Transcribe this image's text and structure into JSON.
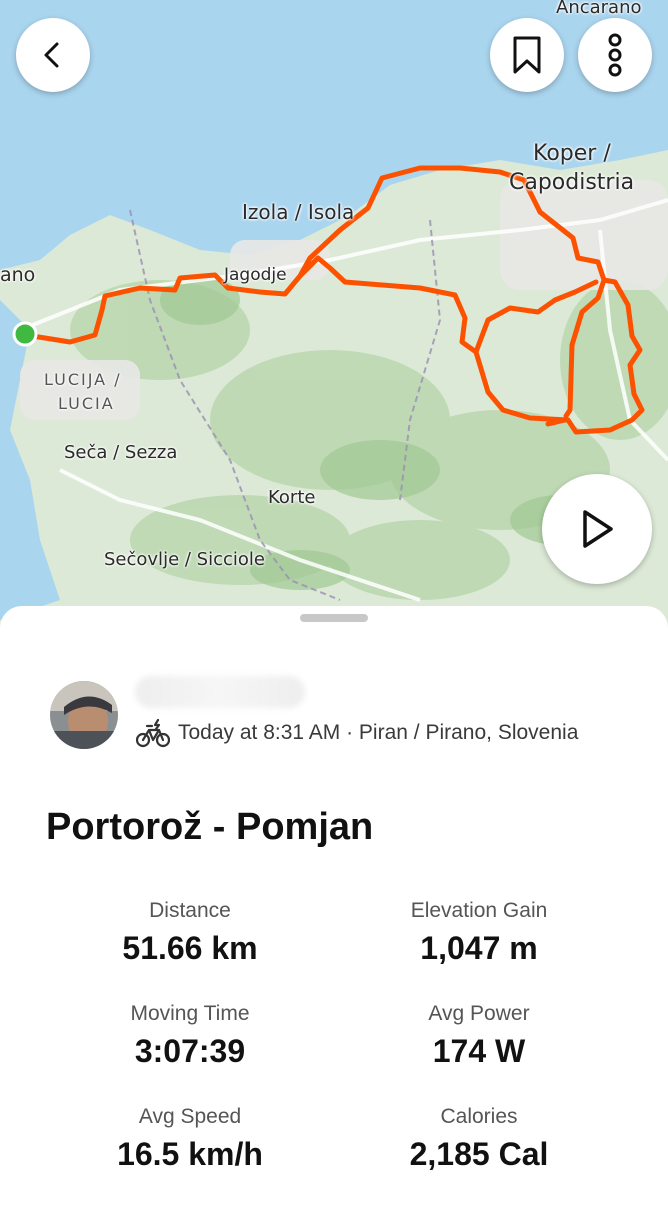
{
  "map": {
    "labels": {
      "ancarano": "Ancarano",
      "koper_1": "Koper /",
      "koper_2": "Capodistria",
      "izola": "Izola / Isola",
      "jagodje": "Jagodje",
      "piran_partial": "ano",
      "lucija_1": "LUCIJA /",
      "lucija_2": "LUCIA",
      "seca": "Seča / Sezza",
      "korte": "Korte",
      "secovlje": "Sečovlje / Sicciole"
    },
    "colors": {
      "sea": "#a9d4ee",
      "land": "#dbe9d4",
      "route": "#fc5200",
      "start": "#3fb93f"
    }
  },
  "toolbar": {
    "back_icon": "chevron-left-icon",
    "bookmark_icon": "bookmark-icon",
    "more_icon": "more-vertical-icon",
    "play_icon": "play-icon"
  },
  "activity": {
    "sport_icon": "e-bike-icon",
    "meta": "Today at 8:31 AM · Piran / Pirano, Slovenia",
    "title": "Portorož - Pomjan"
  },
  "stats": [
    {
      "label": "Distance",
      "value": "51.66 km"
    },
    {
      "label": "Elevation Gain",
      "value": "1,047 m"
    },
    {
      "label": "Moving Time",
      "value": "3:07:39"
    },
    {
      "label": "Avg Power",
      "value": "174 W"
    },
    {
      "label": "Avg Speed",
      "value": "16.5 km/h"
    },
    {
      "label": "Calories",
      "value": "2,185 Cal"
    }
  ]
}
